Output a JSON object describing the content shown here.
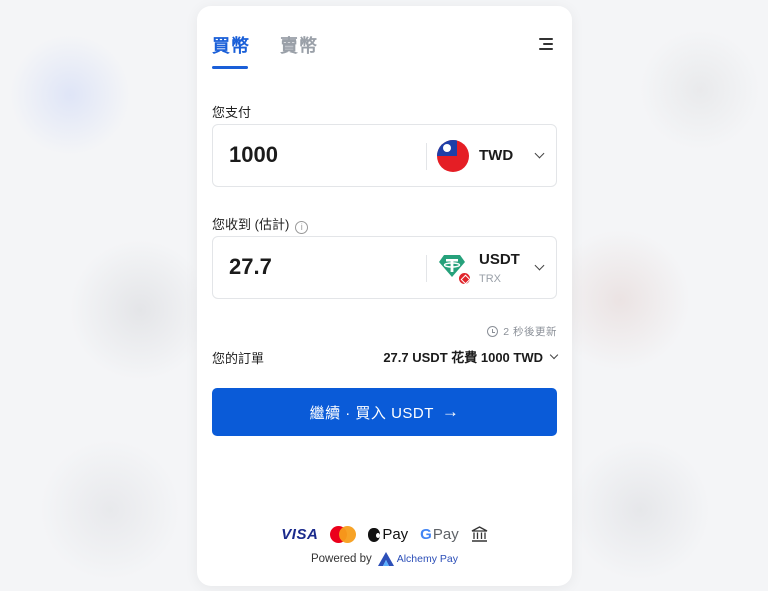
{
  "tabs": [
    {
      "label": "買幣",
      "active": true
    },
    {
      "label": "賣幣",
      "active": false
    }
  ],
  "pay": {
    "label": "您支付",
    "amount": "1000",
    "currency": "TWD"
  },
  "receive": {
    "label": "您收到 (估計)",
    "amount": "27.7",
    "currency": "USDT",
    "network": "TRX"
  },
  "refresh_text": "2 秒後更新",
  "order": {
    "label": "您的訂單",
    "summary": "27.7 USDT 花費 1000 TWD"
  },
  "cta_label": "繼續 · 買入 USDT",
  "payment_methods": {
    "visa": "VISA",
    "apple_pay": "Pay",
    "google_pay": "Pay",
    "google_g": "G"
  },
  "powered_by": "Powered by",
  "provider_name": "Alchemy Pay",
  "colors": {
    "accent": "#0a5bd8",
    "tab_active": "#1a5fd8",
    "tether": "#26a17b",
    "trx": "#e0252b"
  },
  "icons": {
    "menu": "hamburger-menu-icon",
    "info": "info-icon",
    "clock": "clock-icon",
    "arrow": "arrow-right-icon",
    "bank": "bank-icon"
  }
}
